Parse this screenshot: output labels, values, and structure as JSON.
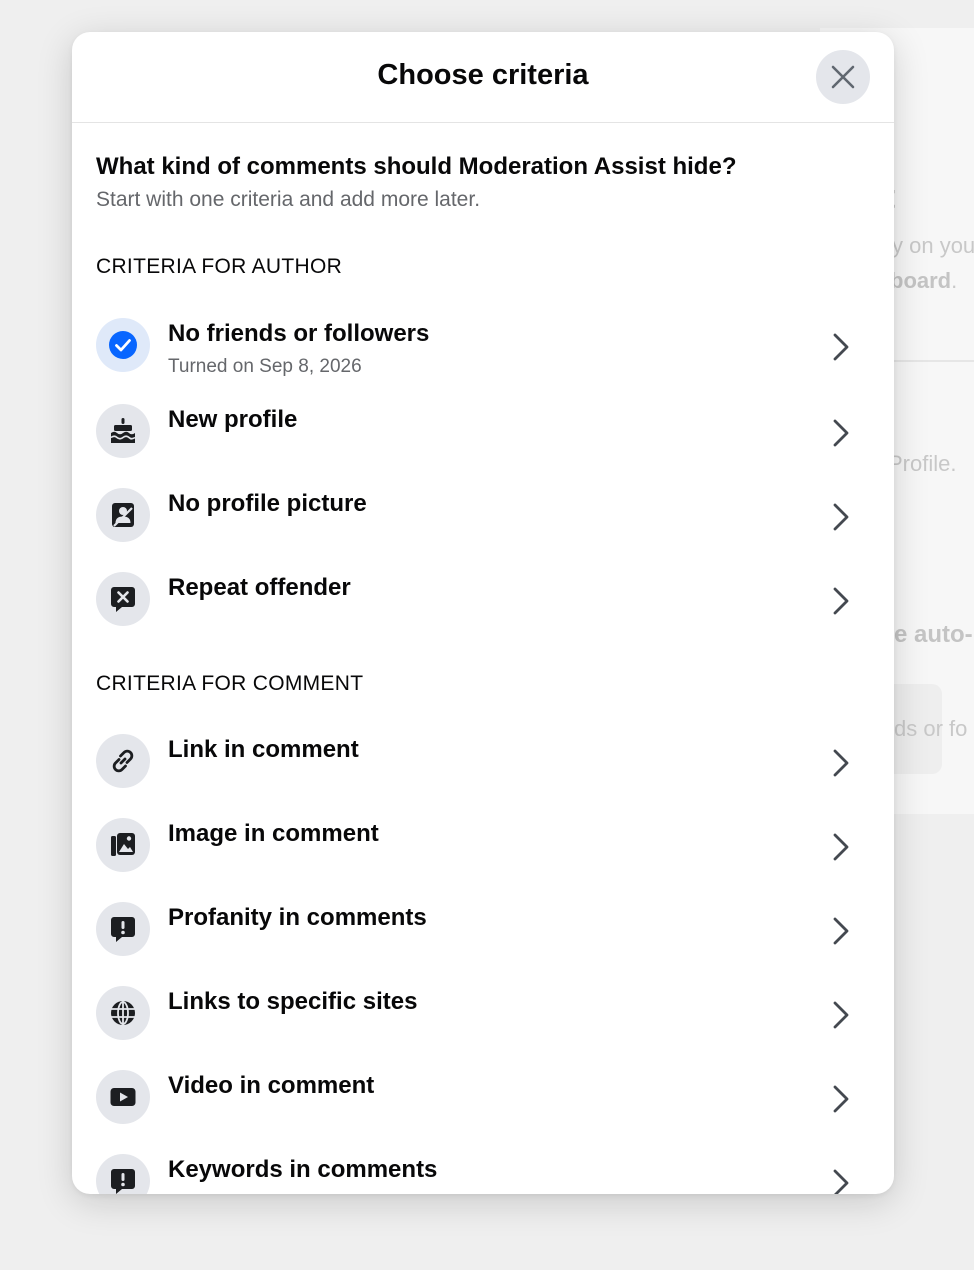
{
  "background": {
    "fragment_t": "t",
    "fragment_on_you": "y on you",
    "fragment_board": "board",
    "fragment_board_period": ".",
    "fragment_profile": "Profile.",
    "fragment_auto": "e auto-",
    "fragment_ds_or_fo": "ds or fo"
  },
  "modal": {
    "title": "Choose criteria",
    "close_icon": "close-icon",
    "question": "What kind of comments should Moderation Assist hide?",
    "subtext": "Start with one criteria and add more later."
  },
  "author_section": {
    "heading": "CRITERIA FOR AUTHOR",
    "items": [
      {
        "label": "No friends or followers",
        "sublabel": "Turned on Sep 8, 2026",
        "icon": "check-circle-icon",
        "active": true
      },
      {
        "label": "New profile",
        "icon": "cake-icon"
      },
      {
        "label": "No profile picture",
        "icon": "profile-picture-icon"
      },
      {
        "label": "Repeat offender",
        "icon": "comment-x-icon"
      }
    ]
  },
  "comment_section": {
    "heading": "CRITERIA FOR COMMENT",
    "items": [
      {
        "label": "Link in comment",
        "icon": "link-icon"
      },
      {
        "label": "Image in comment",
        "icon": "image-icon"
      },
      {
        "label": "Profanity in comments",
        "icon": "comment-alert-icon"
      },
      {
        "label": "Links to specific sites",
        "icon": "globe-icon"
      },
      {
        "label": "Video in comment",
        "icon": "video-play-icon"
      },
      {
        "label": "Keywords in comments",
        "icon": "comment-alert-icon"
      }
    ]
  },
  "colors": {
    "accent": "#0866ff",
    "icon_dark": "#1c1e21",
    "icon_bg": "#e4e6eb",
    "secondary_text": "#65676b"
  }
}
